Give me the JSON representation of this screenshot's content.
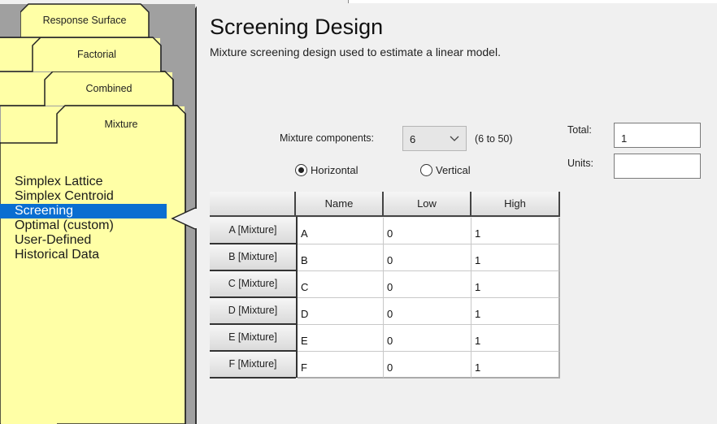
{
  "design_tabs": [
    {
      "label": "Response Surface"
    },
    {
      "label": "Factorial"
    },
    {
      "label": "Combined"
    },
    {
      "label": "Mixture",
      "active": true
    }
  ],
  "mixture_designs": [
    {
      "label": "Simplex Lattice"
    },
    {
      "label": "Simplex Centroid"
    },
    {
      "label": "Screening",
      "selected": true
    },
    {
      "label": "Optimal (custom)"
    },
    {
      "label": "User-Defined"
    },
    {
      "label": "Historical Data"
    }
  ],
  "main": {
    "title": "Screening Design",
    "subtitle": "Mixture screening design used to estimate a linear model.",
    "components_label": "Mixture components:",
    "components_value": "6",
    "components_range": "(6 to 50)",
    "orientation": {
      "horizontal_label": "Horizontal",
      "vertical_label": "Vertical",
      "selected": "Horizontal"
    },
    "total_label": "Total:",
    "total_value": "1",
    "units_label": "Units:",
    "units_value": ""
  },
  "table": {
    "columns": [
      "",
      "Name",
      "Low",
      "High"
    ],
    "rows": [
      {
        "header": "A [Mixture]",
        "name": "A",
        "low": "0",
        "high": "1"
      },
      {
        "header": "B [Mixture]",
        "name": "B",
        "low": "0",
        "high": "1"
      },
      {
        "header": "C [Mixture]",
        "name": "C",
        "low": "0",
        "high": "1"
      },
      {
        "header": "D [Mixture]",
        "name": "D",
        "low": "0",
        "high": "1"
      },
      {
        "header": "E [Mixture]",
        "name": "E",
        "low": "0",
        "high": "1"
      },
      {
        "header": "F [Mixture]",
        "name": "F",
        "low": "0",
        "high": "1"
      }
    ]
  },
  "colors": {
    "tab_yellow": "#ffffa6",
    "selection_blue": "#0a6ed1",
    "panel_gray": "#a0a0a0"
  }
}
